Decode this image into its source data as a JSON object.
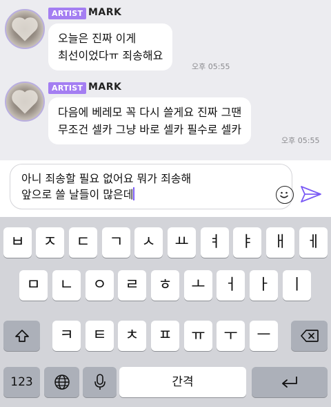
{
  "messages": [
    {
      "badge": "ARTIST",
      "sender": "MARK",
      "lines": [
        "오늘은 진짜 이게",
        "최선이었다ㅠ 죄송해요"
      ],
      "time": "오후 05:55"
    },
    {
      "badge": "ARTIST",
      "sender": "MARK",
      "lines": [
        "다음에 베레모 꼭 다시 쓸게요 진짜 그땐",
        "무조건 셀카 그냥 바로 셀카 필수로 셀카"
      ],
      "time": "오후 05:55"
    }
  ],
  "composer": {
    "lines": [
      "아니 죄송할 필요 없어요 뭐가 죄송해",
      "앞으로 쓸 날들이 많은데"
    ]
  },
  "keyboard": {
    "row1": [
      "ㅂ",
      "ㅈ",
      "ㄷ",
      "ㄱ",
      "ㅅ",
      "ㅛ",
      "ㅕ",
      "ㅑ",
      "ㅐ",
      "ㅔ"
    ],
    "row2": [
      "ㅁ",
      "ㄴ",
      "ㅇ",
      "ㄹ",
      "ㅎ",
      "ㅗ",
      "ㅓ",
      "ㅏ",
      "ㅣ"
    ],
    "row3": [
      "ㅋ",
      "ㅌ",
      "ㅊ",
      "ㅍ",
      "ㅠ",
      "ㅜ",
      "ㅡ"
    ],
    "numbers_label": "123",
    "space_label": "간격"
  },
  "colors": {
    "badge": "#a47ef2",
    "accent": "#7a5af5",
    "chat_bg": "#ececf0",
    "keyboard_bg": "#d3d4d9"
  }
}
